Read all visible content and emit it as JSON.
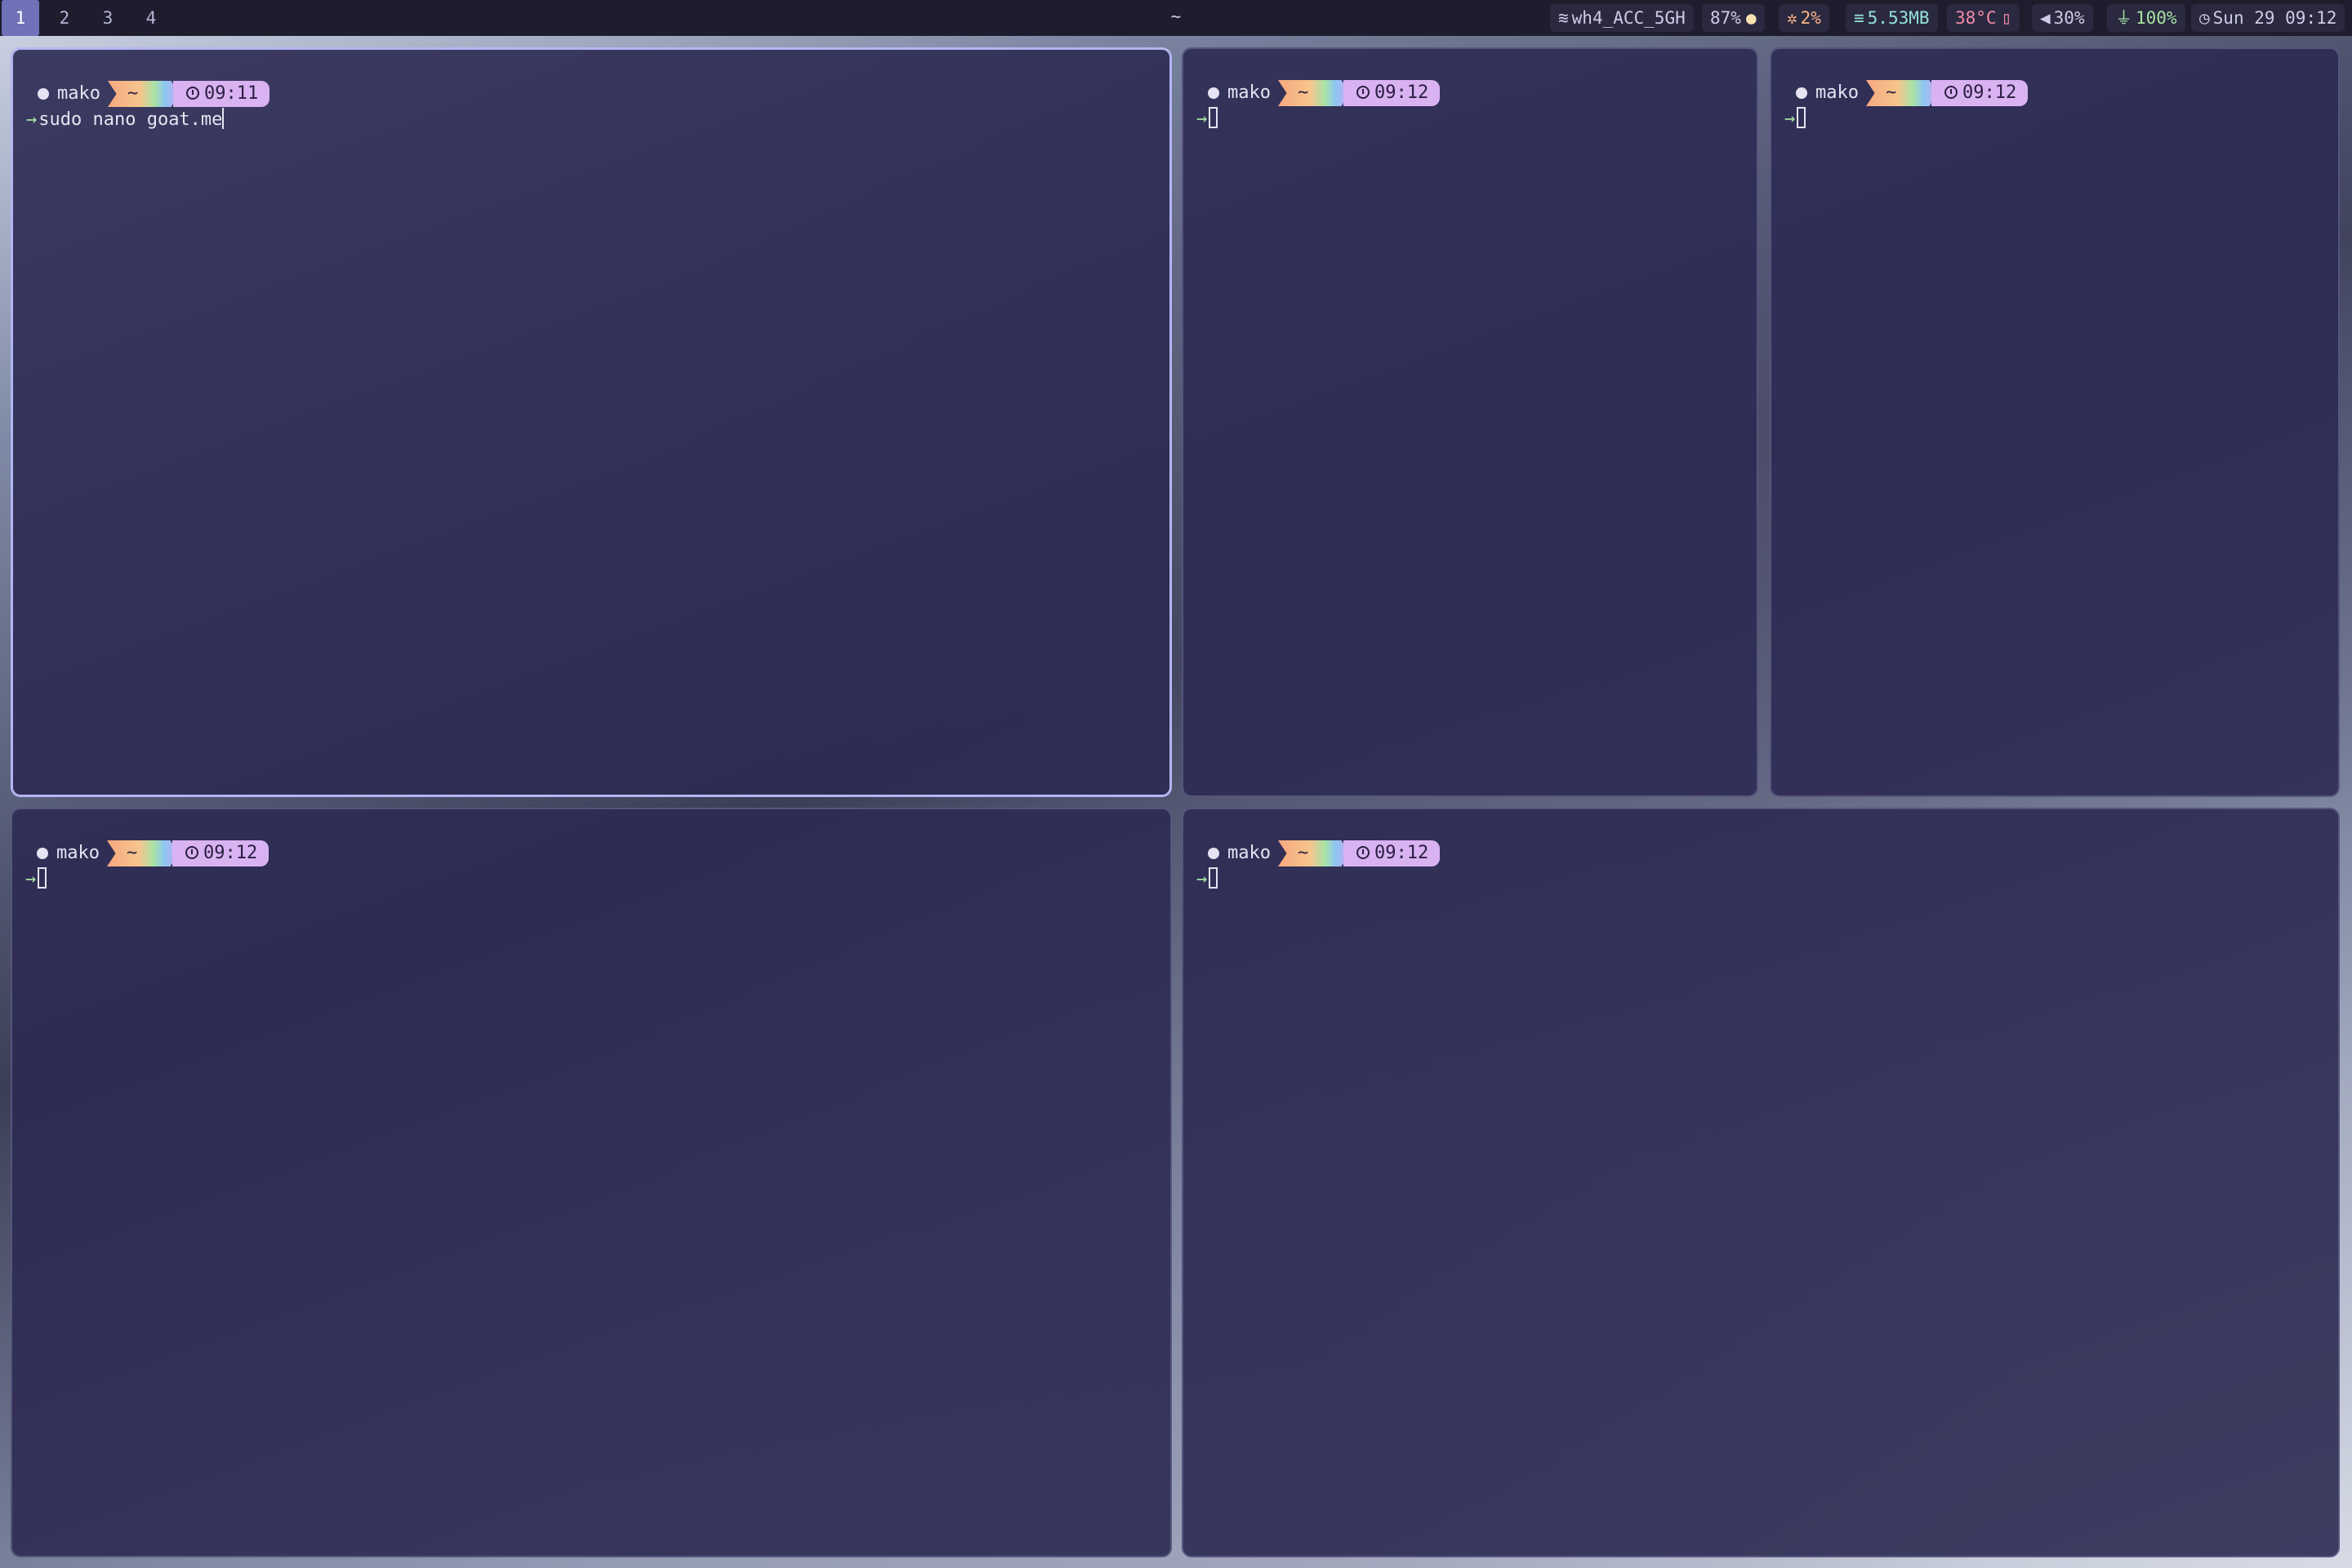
{
  "topbar": {
    "workspaces": [
      "1",
      "2",
      "3",
      "4"
    ],
    "active_workspace": "1",
    "window_title": "~",
    "wifi": "wh4_ACC_5GH",
    "brightness": "87%",
    "cpu": "2%",
    "memory": "5.53MB",
    "temperature": "38°C",
    "volume": "30%",
    "battery": "100%",
    "clock": "Sun 29 09:12"
  },
  "terminals": [
    {
      "user": "mako",
      "dir": "~",
      "time": "09:11",
      "command": "sudo nano goat.me"
    },
    {
      "user": "mako",
      "dir": "~",
      "time": "09:12",
      "command": ""
    },
    {
      "user": "mako",
      "dir": "~",
      "time": "09:12",
      "command": ""
    },
    {
      "user": "mako",
      "dir": "~",
      "time": "09:12",
      "command": ""
    },
    {
      "user": "mako",
      "dir": "~",
      "time": "09:12",
      "command": ""
    }
  ],
  "colors": {
    "bar_bg": "#1e1d2e",
    "active_ws": "#6f72b8",
    "terminal_bg": "#2c2a52",
    "focus_border": "#b3b6f0",
    "prompt_arrow": "#a6e3a1",
    "time_segment": "#d9b2f2",
    "temperature": "#f38ba8",
    "cpu": "#fab387",
    "memory": "#94e2d5",
    "battery": "#a6e3a1"
  }
}
